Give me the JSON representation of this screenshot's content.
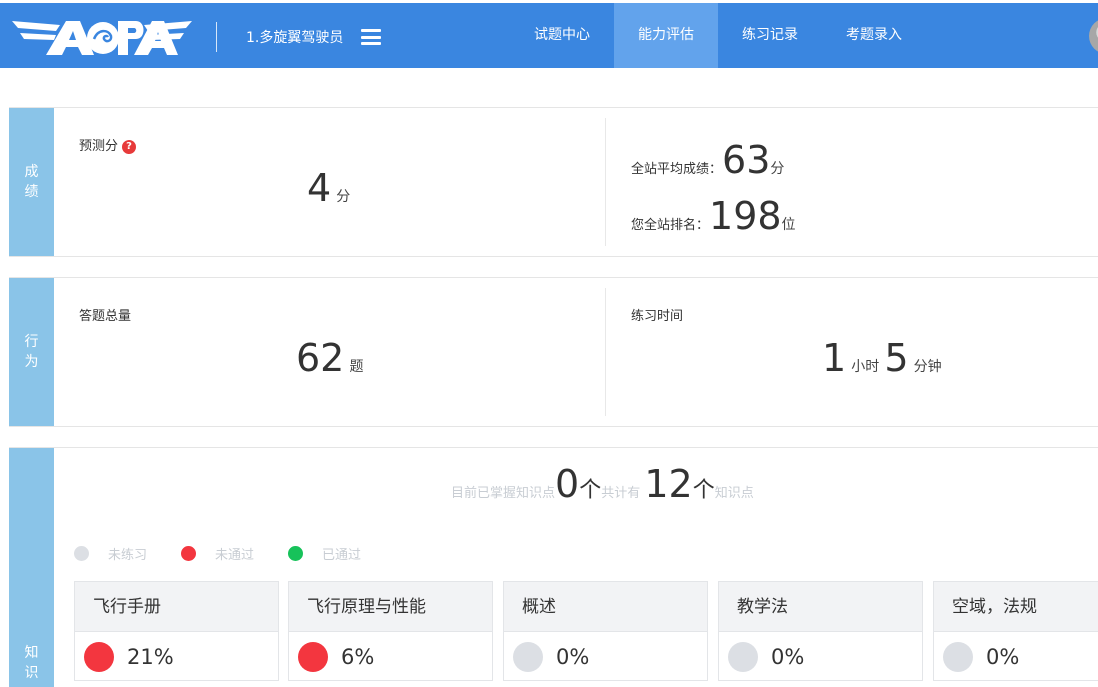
{
  "header": {
    "logo_text": "AOPA",
    "user_title": "1.多旋翼驾驶员",
    "nav": [
      {
        "label": "试题中心",
        "active": false
      },
      {
        "label": "能力评估",
        "active": true
      },
      {
        "label": "练习记录",
        "active": false
      },
      {
        "label": "考题录入",
        "active": false
      }
    ]
  },
  "score": {
    "side_label": [
      "成",
      "绩"
    ],
    "predicted_label": "预测分",
    "help_icon": "?",
    "predicted_value": "4",
    "predicted_unit": "分",
    "avg_label": "全站平均成绩：",
    "avg_value": "63",
    "avg_unit": "分",
    "rank_label": "您全站排名：",
    "rank_value": "198",
    "rank_unit": "位"
  },
  "behavior": {
    "side_label": [
      "行",
      "为"
    ],
    "total_label": "答题总量",
    "total_value": "62",
    "total_unit": "题",
    "time_label": "练习时间",
    "hours_value": "1",
    "hours_unit": "小时",
    "minutes_value": "5",
    "minutes_unit": "分钟"
  },
  "knowledge": {
    "side_label": [
      "知",
      "识"
    ],
    "summary_prefix": "目前已掌握知识点",
    "mastered_value": "0",
    "mastered_unit": "个",
    "summary_mid": "共计有",
    "total_value": "12",
    "total_unit": "个",
    "summary_suffix": "知识点",
    "legend": [
      {
        "label": "未练习",
        "color": "#dcdfe4"
      },
      {
        "label": "未通过",
        "color": "#f3363f"
      },
      {
        "label": "已通过",
        "color": "#17c25a"
      }
    ],
    "cards": [
      {
        "title": "飞行手册",
        "percent": "21%",
        "color": "#f3363f"
      },
      {
        "title": "飞行原理与性能",
        "percent": "6%",
        "color": "#f3363f"
      },
      {
        "title": "概述",
        "percent": "0%",
        "color": "#dcdfe4"
      },
      {
        "title": "教学法",
        "percent": "0%",
        "color": "#dcdfe4"
      },
      {
        "title": "空域，法规",
        "percent": "0%",
        "color": "#dcdfe4"
      }
    ]
  },
  "colors": {
    "header_bg": "#3a86e0",
    "nav_active_bg": "#62a3ec",
    "side_bar": "#8ac4e8"
  }
}
